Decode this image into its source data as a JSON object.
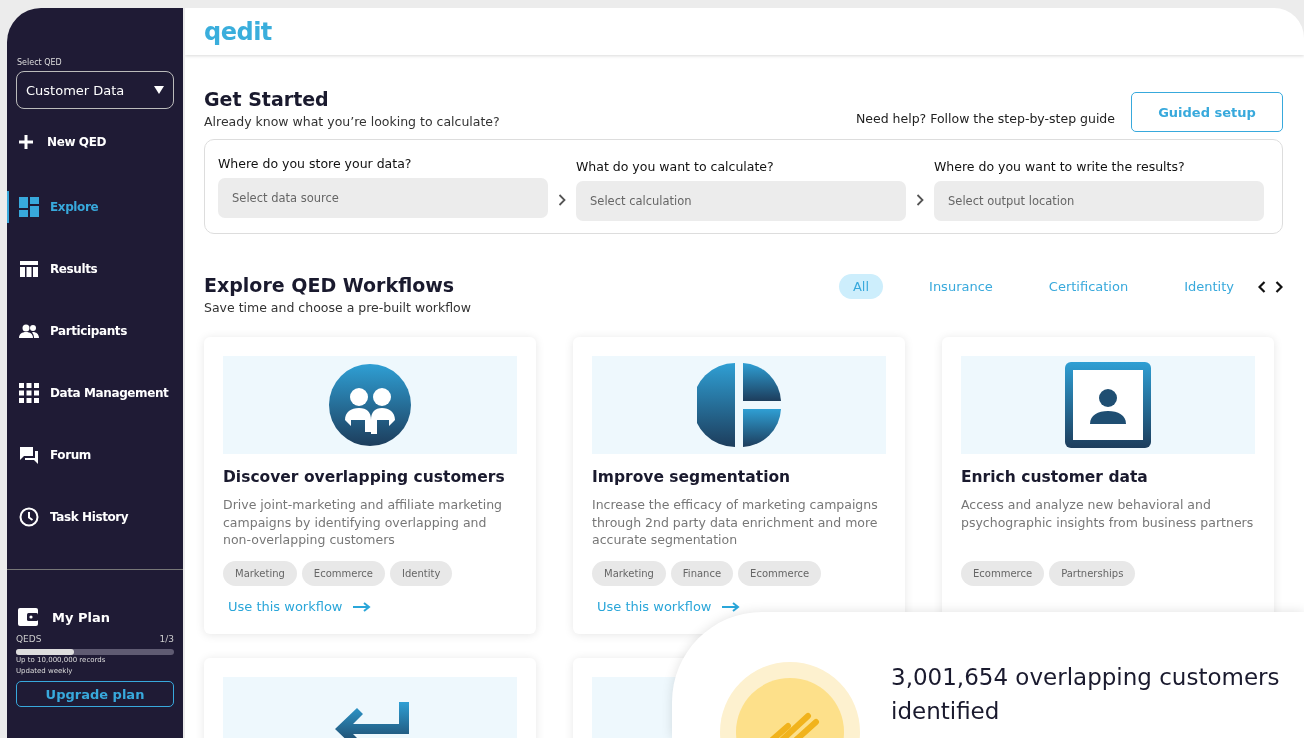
{
  "sidebar": {
    "select_label": "Select QED",
    "select_value": "Customer Data",
    "new_button": "New QED",
    "items": [
      {
        "label": "Explore",
        "kind": "dashboard",
        "selected": true
      },
      {
        "label": "Results",
        "kind": "table",
        "selected": false
      },
      {
        "label": "Participants",
        "kind": "people",
        "selected": false
      },
      {
        "label": "Data Management",
        "kind": "grid",
        "selected": false
      },
      {
        "label": "Forum",
        "kind": "chat",
        "selected": false
      },
      {
        "label": "Task History",
        "kind": "clock",
        "selected": false
      }
    ],
    "plan": {
      "title": "My Plan",
      "meter_label": "QEDS",
      "meter_count": "1/3",
      "level": 0.37,
      "notes": [
        "Up to 10,000,000 records",
        "Updated weekly"
      ],
      "upgrade_button": "Upgrade plan"
    }
  },
  "header": {
    "logo": "qedit"
  },
  "get_started": {
    "title": "Get Started",
    "subtitle": "Already know what you’re looking to calculate?",
    "help_text": "Need help? Follow the step-by-step guide",
    "guided_button": "Guided setup",
    "steps": [
      {
        "label": "Where do you store your data?",
        "placeholder": "Select data source"
      },
      {
        "label": "What do you want to calculate?",
        "placeholder": "Select calculation"
      },
      {
        "label": "Where do you want to write the results?",
        "placeholder": "Select output location"
      }
    ]
  },
  "workflows": {
    "title": "Explore QED Workflows",
    "subtitle": "Save time and choose a pre-built workflow",
    "filters": [
      {
        "label": "All",
        "selected": true
      },
      {
        "label": "Insurance",
        "selected": false
      },
      {
        "label": "Certification",
        "selected": false
      },
      {
        "label": "Identity",
        "selected": false
      }
    ],
    "cards": [
      {
        "kind": "people",
        "title": "Discover overlapping customers",
        "description": "Drive joint-marketing and affiliate marketing campaigns by identifying overlapping and non-overlapping customers",
        "tags": [
          "Marketing",
          "Ecommerce",
          "Identity"
        ],
        "link": "Use this workflow"
      },
      {
        "kind": "pie",
        "title": "Improve segmentation",
        "description": "Increase the efficacy of marketing campaigns through 2nd party data enrichment and more accurate segmentation",
        "tags": [
          "Marketing",
          "Finance",
          "Ecommerce"
        ],
        "link": "Use this workflow"
      },
      {
        "kind": "portrait",
        "title": "Enrich customer data",
        "description": "Access and analyze new behavioral and psychographic insights from business partners",
        "tags": [
          "Ecommerce",
          "Partnerships"
        ]
      },
      {
        "kind": "return"
      },
      {
        "kind": "blank"
      }
    ]
  },
  "notification": {
    "text": "3,001,654 overlapping customers identified"
  }
}
